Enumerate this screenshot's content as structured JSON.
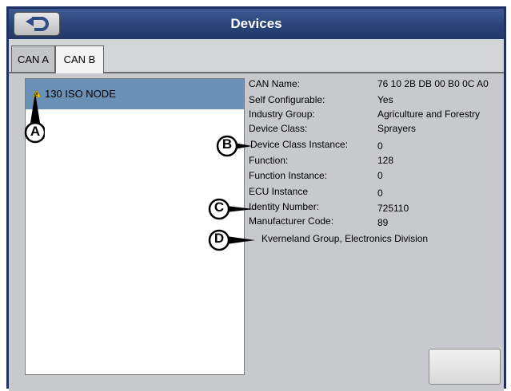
{
  "header": {
    "title": "Devices",
    "back_icon": "back-arrow-icon"
  },
  "tabs": [
    {
      "label": "CAN A",
      "selected": false
    },
    {
      "label": "CAN B",
      "selected": true
    }
  ],
  "device_list": [
    {
      "label": "130 ISO NODE",
      "status_icon": "warning-icon",
      "selected": true
    }
  ],
  "properties": [
    {
      "label": "CAN Name:",
      "value": "76 10 2B DB 00 B0 0C A0"
    },
    {
      "label": "Self Configurable:",
      "value": "Yes"
    },
    {
      "label": "Industry Group:",
      "value": "Agriculture and Forestry"
    },
    {
      "label": "Device Class:",
      "value": "Sprayers"
    },
    {
      "label": "Device Class Instance:",
      "value": "0"
    },
    {
      "label": "Function:",
      "value": "128"
    },
    {
      "label": "Function Instance:",
      "value": "0"
    },
    {
      "label": "ECU Instance",
      "value": "0"
    },
    {
      "label": "Identity Number:",
      "value": "725110"
    },
    {
      "label": "Manufacturer Code:",
      "value": "89"
    }
  ],
  "manufacturer_name": "Kverneland Group, Electronics Division",
  "callouts": [
    "A",
    "B",
    "C",
    "D"
  ],
  "colors": {
    "title_bar": "#2a437a",
    "selected_row": "#6a90b6",
    "panel": "#c7c9cc",
    "warning": "#f2c200"
  }
}
